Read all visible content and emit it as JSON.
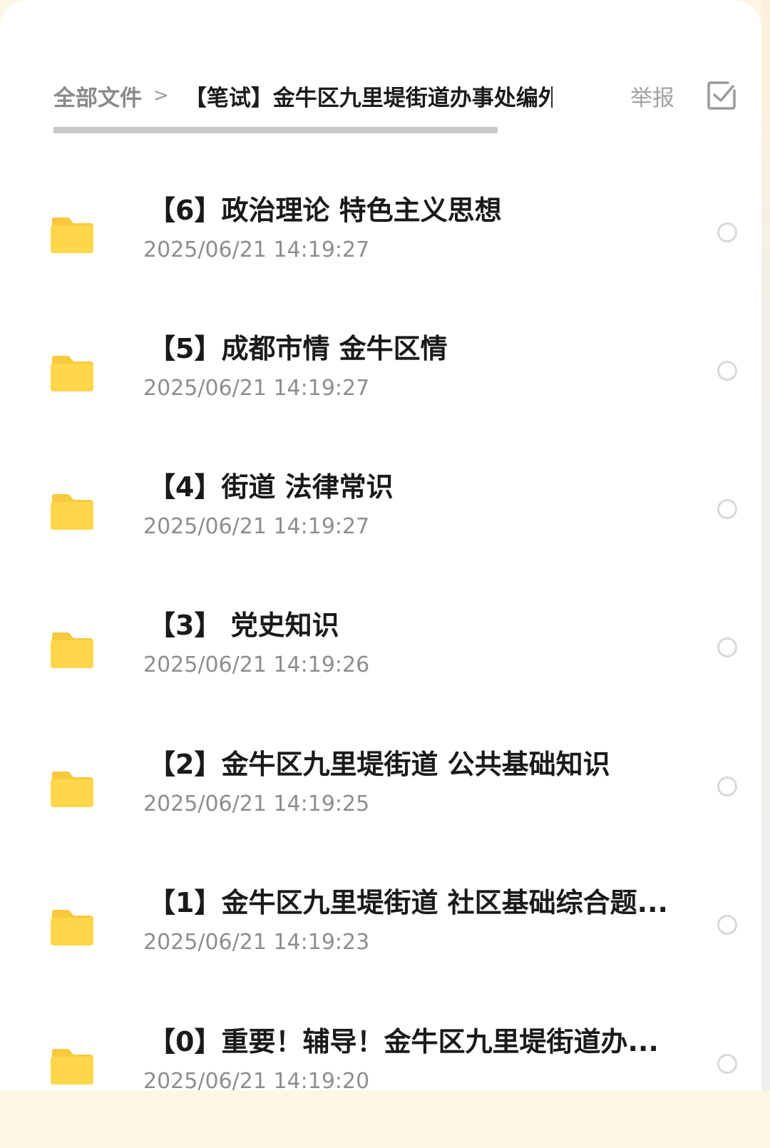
{
  "breadcrumb": {
    "root": "全部文件",
    "separator": ">",
    "current": "【笔试】金牛区九里堤街道办事处编外"
  },
  "actions": {
    "report_label": "举报",
    "select_icon": "checkbox-edit-icon"
  },
  "colors": {
    "folder": "#FFD749",
    "folder_tab": "#F8C93C",
    "title_text": "#1A1A1A",
    "meta_text": "#8E8E8E",
    "background_tint": "#FDF6E6"
  },
  "files": [
    {
      "name": "【6】政治理论 特色主义思想",
      "time": "2025/06/21 14:19:27",
      "icon": "folder-icon"
    },
    {
      "name": "【5】成都市情 金牛区情",
      "time": "2025/06/21 14:19:27",
      "icon": "folder-icon"
    },
    {
      "name": "【4】街道 法律常识",
      "time": "2025/06/21 14:19:27",
      "icon": "folder-icon"
    },
    {
      "name": "【3】 党史知识",
      "time": "2025/06/21 14:19:26",
      "icon": "folder-icon"
    },
    {
      "name": "【2】金牛区九里堤街道 公共基础知识",
      "time": "2025/06/21 14:19:25",
      "icon": "folder-icon"
    },
    {
      "name": "【1】金牛区九里堤街道 社区基础综合题...",
      "time": "2025/06/21 14:19:23",
      "icon": "folder-icon"
    },
    {
      "name": "【0】重要！辅导！金牛区九里堤街道办...",
      "time": "2025/06/21 14:19:20",
      "icon": "folder-icon"
    }
  ]
}
